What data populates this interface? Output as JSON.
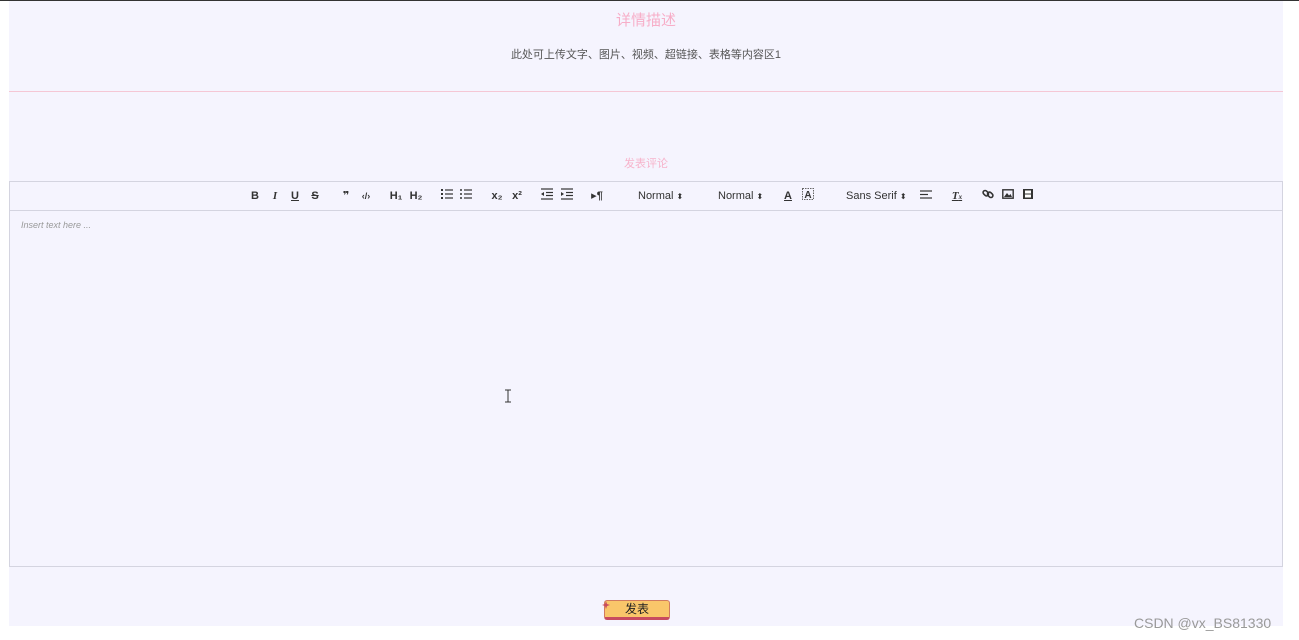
{
  "detail": {
    "title": "详情描述",
    "text": "此处可上传文字、图片、视频、超链接、表格等内容区1"
  },
  "comment": {
    "title": "发表评论"
  },
  "toolbar": {
    "header_select": "Normal",
    "size_select": "Normal",
    "font_select": "Sans Serif"
  },
  "editor": {
    "placeholder": "Insert text here ..."
  },
  "submit": {
    "label": "发表"
  },
  "watermark": "CSDN @vx_BS81330"
}
